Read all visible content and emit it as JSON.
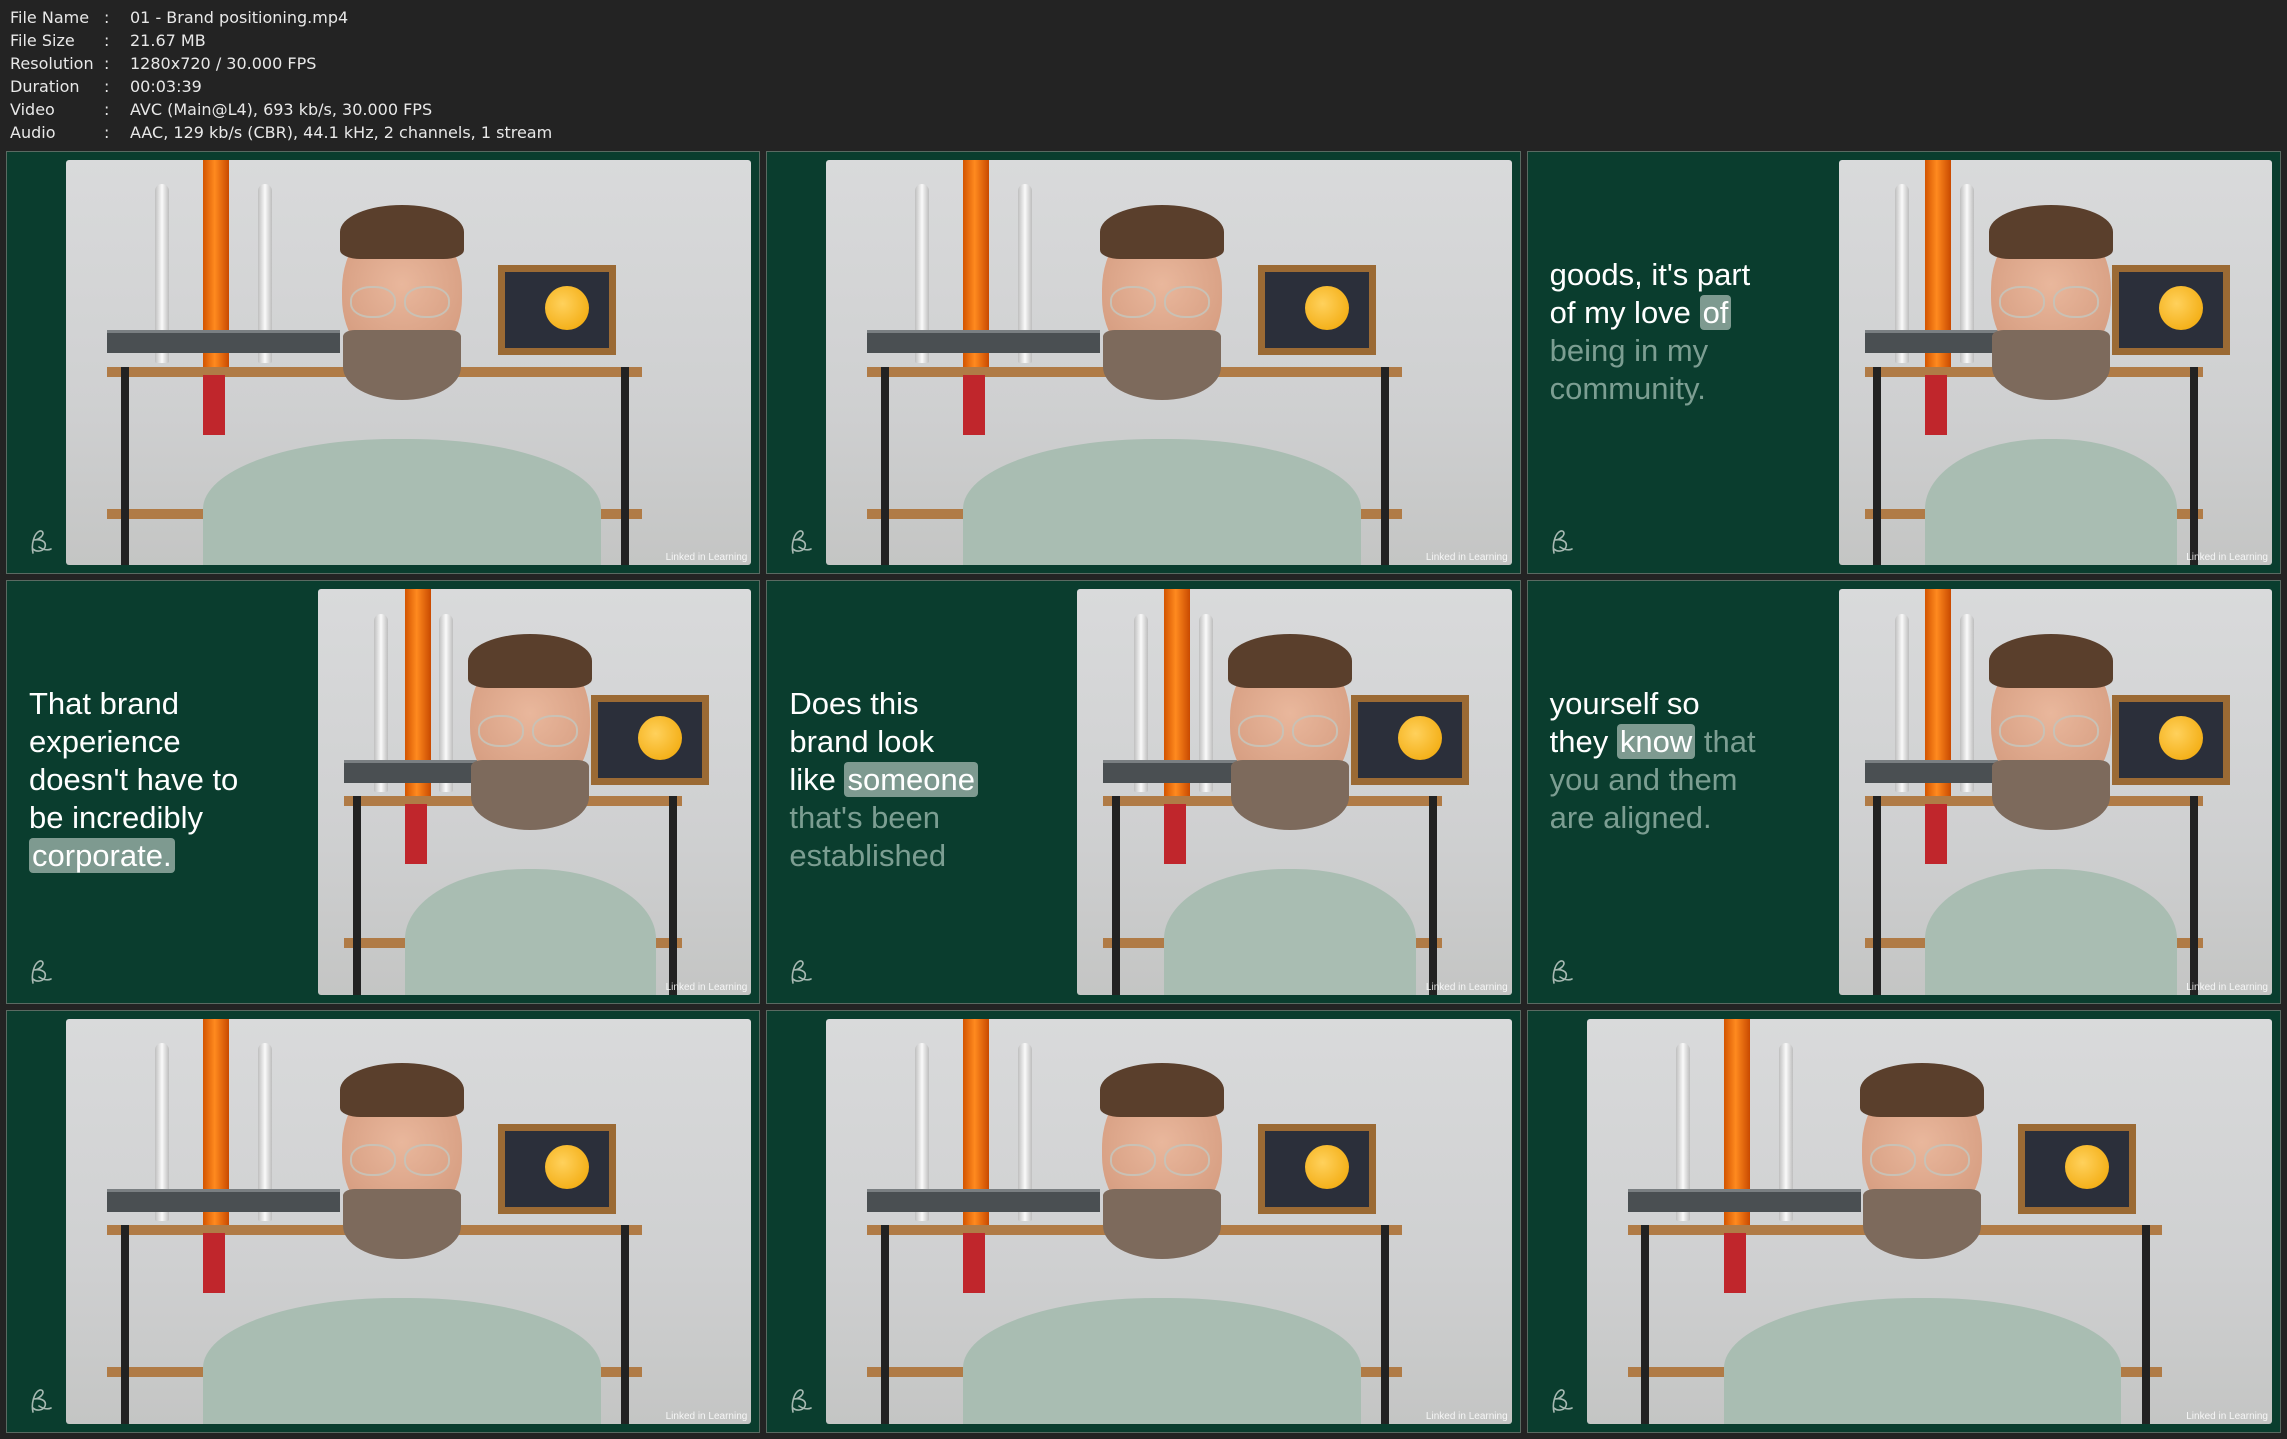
{
  "file_info": [
    {
      "label": "File Name",
      "value": "01 - Brand positioning.mp4"
    },
    {
      "label": "File Size",
      "value": "21.67 MB"
    },
    {
      "label": "Resolution",
      "value": "1280x720 / 30.000 FPS"
    },
    {
      "label": "Duration",
      "value": "00:03:39"
    },
    {
      "label": "Video",
      "value": "AVC (Main@L4), 693 kb/s, 30.000 FPS"
    },
    {
      "label": "Audio",
      "value": "AAC, 129 kb/s (CBR), 44.1 kHz, 2 channels, 1 stream"
    }
  ],
  "separator": ":",
  "watermark": "Linked in Learning",
  "colors": {
    "tile_bg": "#0a3d2e",
    "highlight": "#7e9a90",
    "dim_text": "#7c9e92"
  },
  "thumbnails": [
    {
      "caption": []
    },
    {
      "caption": []
    },
    {
      "caption": [
        {
          "t": "goods, it's part",
          "s": "normal"
        },
        {
          "t": "of my love",
          "s": "normal"
        },
        {
          "t": "of",
          "s": "highlight"
        },
        {
          "t": "being in my",
          "s": "dim"
        },
        {
          "t": "community.",
          "s": "dim"
        }
      ]
    },
    {
      "caption": [
        {
          "t": "That brand",
          "s": "normal"
        },
        {
          "t": "experience",
          "s": "normal"
        },
        {
          "t": "doesn't have to",
          "s": "normal"
        },
        {
          "t": "be incredibly",
          "s": "normal"
        },
        {
          "t": "corporate.",
          "s": "highlight"
        }
      ]
    },
    {
      "caption": [
        {
          "t": "Does this",
          "s": "normal"
        },
        {
          "t": "brand look",
          "s": "normal"
        },
        {
          "t": "like",
          "s": "normal"
        },
        {
          "t": "someone",
          "s": "highlight"
        },
        {
          "t": "that's been",
          "s": "dim"
        },
        {
          "t": "established",
          "s": "dim"
        }
      ]
    },
    {
      "caption": [
        {
          "t": "yourself so",
          "s": "normal"
        },
        {
          "t": "they",
          "s": "normal"
        },
        {
          "t": "know",
          "s": "highlight"
        },
        {
          "t": "that",
          "s": "dim"
        },
        {
          "t": "you and them",
          "s": "dim"
        },
        {
          "t": "are aligned.",
          "s": "dim"
        }
      ]
    },
    {
      "caption": []
    },
    {
      "caption": []
    },
    {
      "caption": []
    }
  ]
}
